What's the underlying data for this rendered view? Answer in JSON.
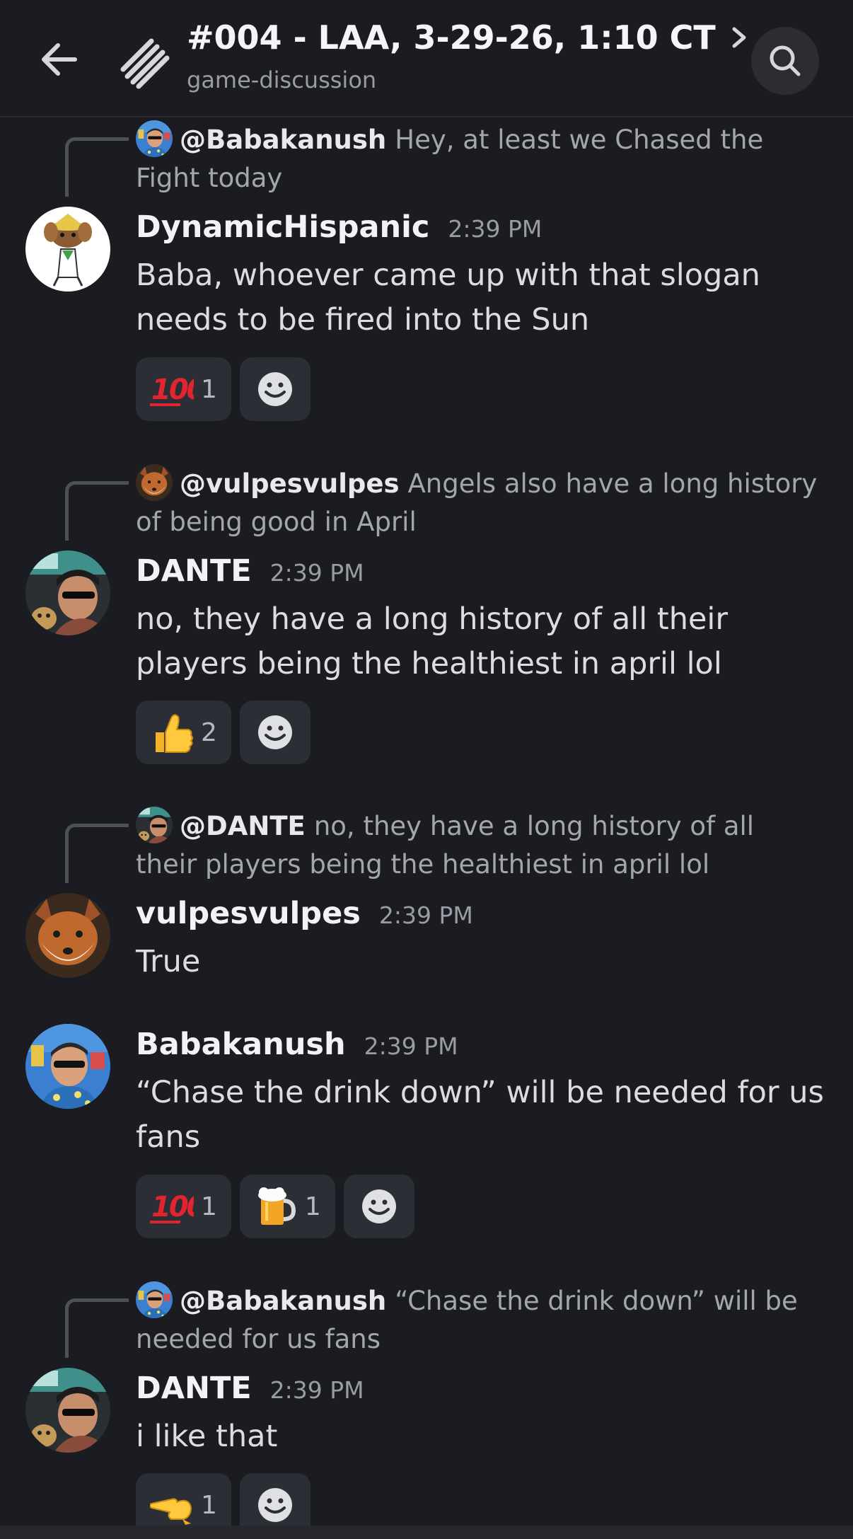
{
  "header": {
    "title": "#004 - LAA, 3-29-26, 1:10 CT",
    "subtitle": "game-discussion",
    "back_icon": "arrow-left-icon",
    "thread_icon": "threads-icon",
    "search_icon": "search-icon"
  },
  "messages": [
    {
      "reply": {
        "mention": "@Babakanush",
        "text": "Hey, at least we Chased the Fight today"
      },
      "author": "DynamicHispanic",
      "time": "2:39 PM",
      "text": "Baba, whoever came up with that slogan needs to be fired into the Sun",
      "reactions": [
        {
          "emoji": "hundred-points",
          "count": "1"
        }
      ]
    },
    {
      "reply": {
        "mention": "@vulpesvulpes",
        "text": "Angels also have a long history of being good in April"
      },
      "author": "DANTE",
      "time": "2:39 PM",
      "text": "no, they have a long history of all their players being the healthiest in april lol",
      "reactions": [
        {
          "emoji": "thumbs-up",
          "count": "2"
        }
      ]
    },
    {
      "reply": {
        "mention": "@DANTE",
        "text": "no, they have a long history of all their players being the healthiest in april lol"
      },
      "author": "vulpesvulpes",
      "time": "2:39 PM",
      "text": "True"
    },
    {
      "author": "Babakanush",
      "time": "2:39 PM",
      "text": "“Chase the drink down” will be needed for us fans",
      "reactions": [
        {
          "emoji": "hundred-points",
          "count": "1"
        },
        {
          "emoji": "beer-mug",
          "count": "1"
        }
      ]
    },
    {
      "reply": {
        "mention": "@Babakanush",
        "text": "“Chase the drink down” will be needed for us fans"
      },
      "author": "DANTE",
      "time": "2:39 PM",
      "text": "i like that",
      "reactions": [
        {
          "emoji": "pointing-left",
          "count": "1"
        }
      ]
    }
  ],
  "colors": {
    "background": "#1b1c21",
    "reaction_bg": "#2c2e35",
    "muted_text": "#9a9ca4"
  }
}
